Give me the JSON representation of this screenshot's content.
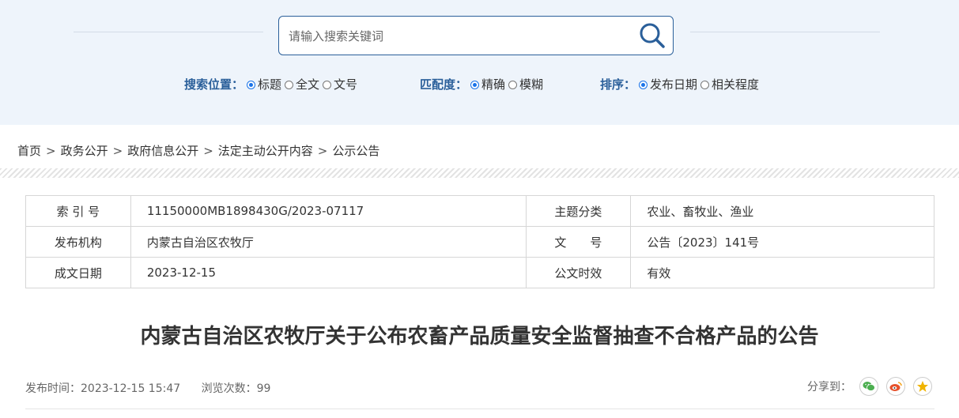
{
  "search": {
    "placeholder": "请输入搜索关键词"
  },
  "options": {
    "position": {
      "label": "搜索位置：",
      "choices": [
        "标题",
        "全文",
        "文号"
      ],
      "selected": "标题"
    },
    "match": {
      "label": "匹配度：",
      "choices": [
        "精确",
        "模糊"
      ],
      "selected": "精确"
    },
    "sort": {
      "label": "排序：",
      "choices": [
        "发布日期",
        "相关程度"
      ],
      "selected": "发布日期"
    }
  },
  "breadcrumb": [
    "首页",
    "政务公开",
    "政府信息公开",
    "法定主动公开内容",
    "公示公告"
  ],
  "breadcrumb_sep": ">",
  "meta": {
    "index_label": "索 引 号",
    "index_value": "11150000MB1898430G/2023-07117",
    "topic_label": "主题分类",
    "topic_value": "农业、畜牧业、渔业",
    "org_label": "发布机构",
    "org_value": "内蒙古自治区农牧厅",
    "doc_label": "文　　号",
    "doc_value": "公告〔2023〕141号",
    "date_label": "成文日期",
    "date_value": "2023-12-15",
    "valid_label": "公文时效",
    "valid_value": "有效"
  },
  "article": {
    "title": "内蒙古自治区农牧厅关于公布农畜产品质量安全监督抽查不合格产品的公告",
    "publish_label": "发布时间：",
    "publish_time": "2023-12-15 15:47",
    "views_label": "浏览次数：",
    "views": "99",
    "share_label": "分享到："
  },
  "colors": {
    "accent": "#2a5f9a",
    "radio": "#1a73e8",
    "wechat": "#4caf50",
    "weibo": "#e6512b",
    "qzone": "#f0b400"
  },
  "icons": [
    "search-icon",
    "wechat-icon",
    "weibo-icon",
    "qzone-icon"
  ]
}
